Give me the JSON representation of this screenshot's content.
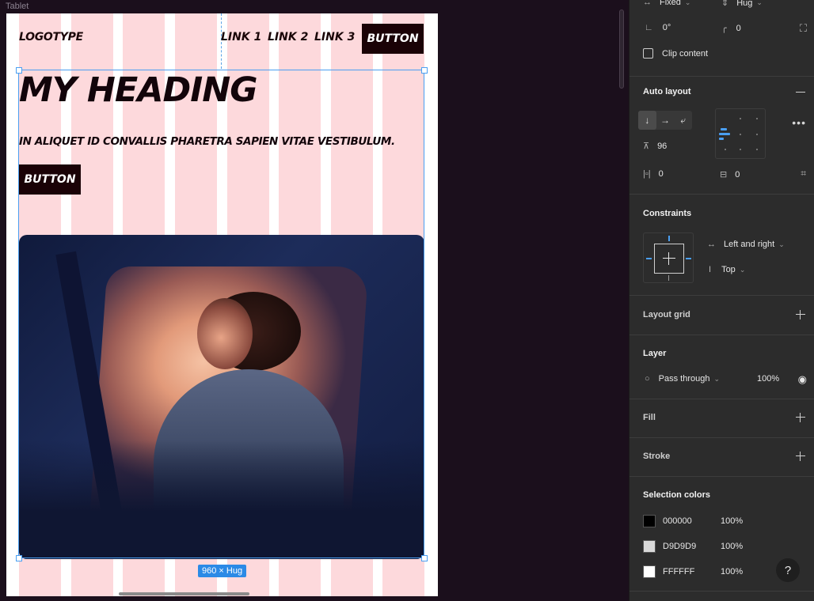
{
  "canvas": {
    "frame_name": "Tablet",
    "logotype": "LOGOTYPE",
    "nav_links": [
      "LINK 1",
      "LINK 2",
      "LINK 3"
    ],
    "nav_button": "BUTTON",
    "heading": "MY HEADING",
    "subheading": "IN ALIQUET ID CONVALLIS PHARETRA SAPIEN VITAE VESTIBULUM.",
    "hero_button": "BUTTON",
    "size_badge": "960 × Hug"
  },
  "panel": {
    "sizing": {
      "width_mode": "Fixed",
      "height_mode": "Hug"
    },
    "rotation": "0°",
    "corner_radius": "0",
    "clip_content_label": "Clip content",
    "auto_layout": {
      "title": "Auto layout",
      "gap": "96",
      "padding_horizontal": "0",
      "padding_vertical": "0"
    },
    "constraints": {
      "title": "Constraints",
      "horizontal": "Left and right",
      "vertical": "Top"
    },
    "layout_grid": {
      "title": "Layout grid"
    },
    "layer": {
      "title": "Layer",
      "blend": "Pass through",
      "opacity": "100%"
    },
    "fill": {
      "title": "Fill"
    },
    "stroke": {
      "title": "Stroke"
    },
    "selection_colors": {
      "title": "Selection colors",
      "items": [
        {
          "hex": "000000",
          "opacity": "100%",
          "swatch": "#000000"
        },
        {
          "hex": "D9D9D9",
          "opacity": "100%",
          "swatch": "#D9D9D9"
        },
        {
          "hex": "FFFFFF",
          "opacity": "100%",
          "swatch": "#FFFFFF"
        }
      ]
    },
    "help_label": "?"
  }
}
